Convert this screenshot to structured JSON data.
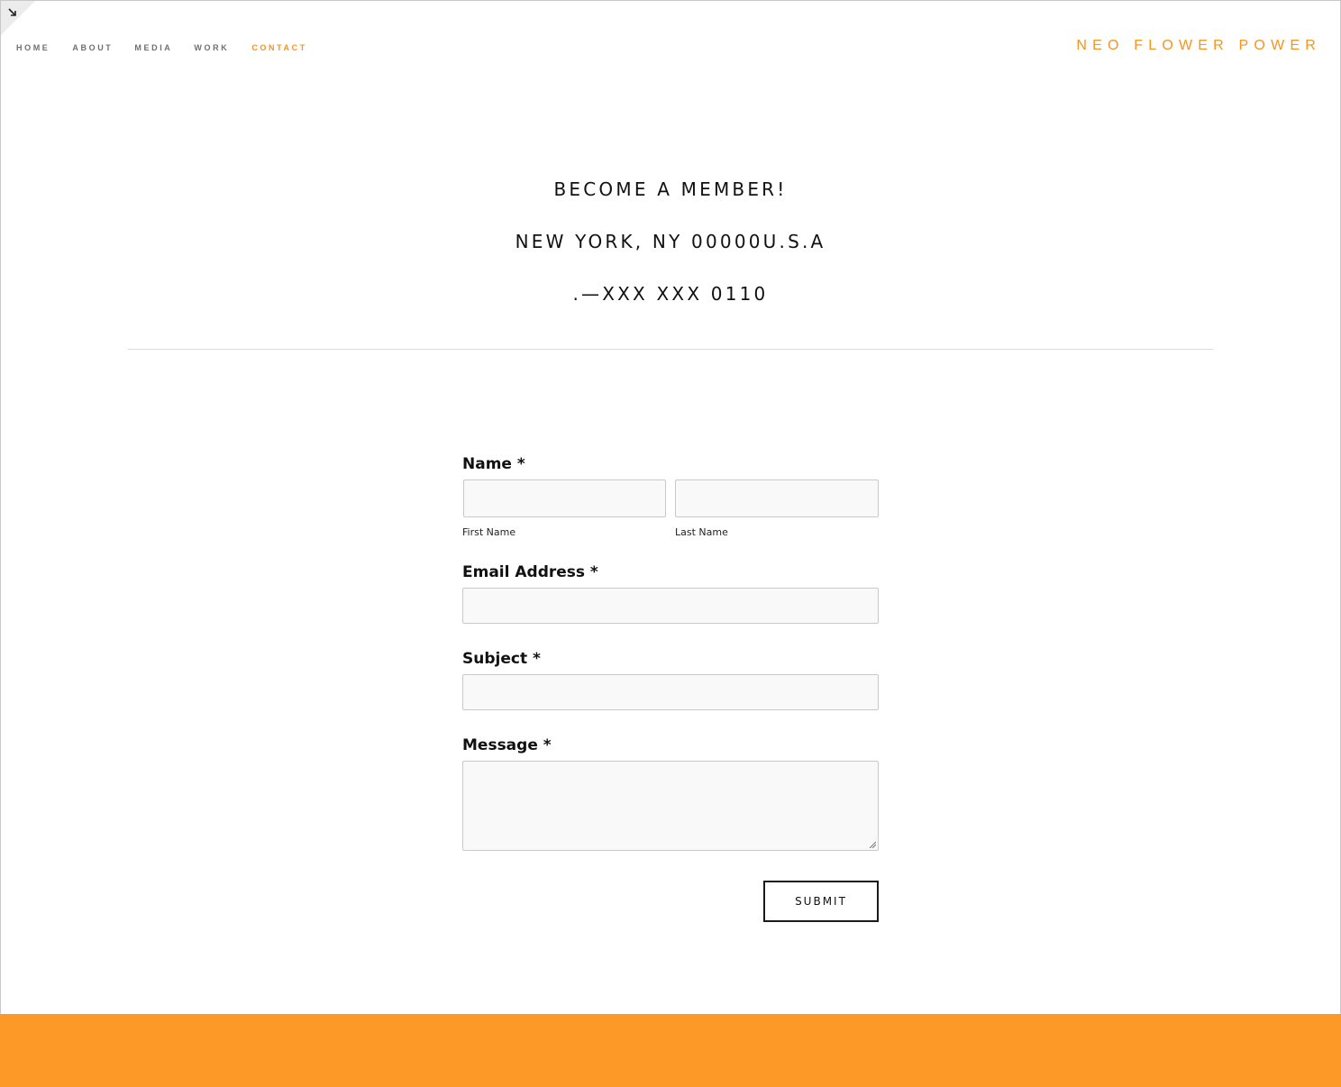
{
  "nav": {
    "items": [
      {
        "label": "HOME",
        "active": false
      },
      {
        "label": "ABOUT",
        "active": false
      },
      {
        "label": "MEDIA",
        "active": false
      },
      {
        "label": "WORK",
        "active": false
      },
      {
        "label": "CONTACT",
        "active": true
      }
    ]
  },
  "brand": {
    "title": "NEO FLOWER POWER"
  },
  "hero": {
    "line1": "BECOME A MEMBER!",
    "line2": "NEW YORK, NY 00000U.S.A",
    "line3": ".—XXX XXX 0110"
  },
  "form": {
    "name_label": "Name *",
    "first_name_label": "First Name",
    "first_name_value": "",
    "last_name_label": "Last Name",
    "last_name_value": "",
    "email_label": "Email Address *",
    "email_value": "",
    "subject_label": "Subject *",
    "subject_value": "",
    "message_label": "Message *",
    "message_value": "",
    "submit_label": "SUBMIT"
  },
  "colors": {
    "accent": "#f7931e",
    "footer": "#fd9a27",
    "field_bg": "#f9f9f9",
    "field_border": "#c9c9c9"
  },
  "icons": {
    "corner": "expand-arrow-icon",
    "resize": "resize-grip-icon"
  }
}
